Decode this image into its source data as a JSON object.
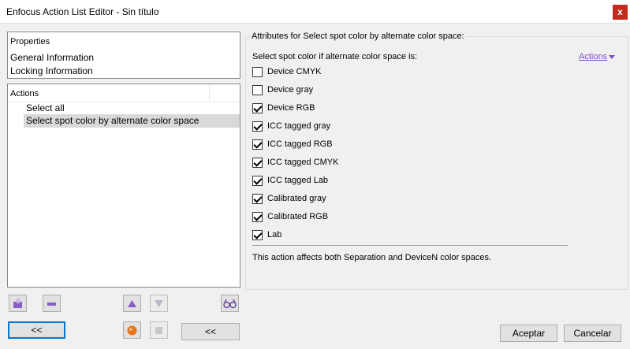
{
  "window": {
    "title": "Enfocus Action List Editor - Sin título",
    "close_glyph": "x"
  },
  "properties": {
    "header": "Properties",
    "items": [
      "General Information",
      "Locking Information"
    ]
  },
  "actions_list": {
    "header": "Actions",
    "items": [
      {
        "label": "Select all",
        "selected": false
      },
      {
        "label": "Select spot color by alternate color space",
        "selected": true
      }
    ]
  },
  "attributes": {
    "title": "Attributes for Select spot color by alternate color space:",
    "subtitle": "Select spot color if alternate color space is:",
    "actions_link": "Actions",
    "options": [
      {
        "label": "Device CMYK",
        "checked": false
      },
      {
        "label": "Device gray",
        "checked": false
      },
      {
        "label": "Device RGB",
        "checked": true
      },
      {
        "label": "ICC tagged gray",
        "checked": true
      },
      {
        "label": "ICC tagged RGB",
        "checked": true
      },
      {
        "label": "ICC tagged CMYK",
        "checked": true
      },
      {
        "label": "ICC tagged Lab",
        "checked": true
      },
      {
        "label": "Calibrated gray",
        "checked": true
      },
      {
        "label": "Calibrated RGB",
        "checked": true
      },
      {
        "label": "Lab",
        "checked": true
      }
    ],
    "note": "This action affects both Separation and DeviceN color spaces."
  },
  "toolbar": {
    "collapse_left_label": "<<",
    "collapse_mid_label": "<<",
    "icons": [
      "add-action-icon",
      "remove-action-icon",
      "move-up-icon",
      "move-down-icon",
      "glasses-icon",
      "run-icon",
      "stop-icon"
    ],
    "accent_color": "#8a5cc7"
  },
  "footer": {
    "accept_label": "Aceptar",
    "cancel_label": "Cancelar"
  }
}
